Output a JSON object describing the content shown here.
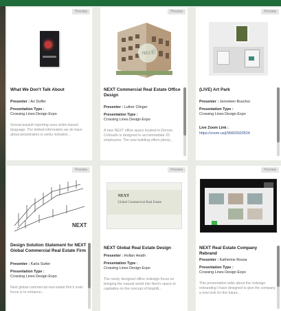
{
  "preview_label": "Preview",
  "cards": [
    {
      "title": "What We Don't Talk About",
      "presenter_label": "Presenter :",
      "presenter": "Ari Duffer",
      "type_label": "Presentation Type :",
      "type": "Crossing Lines Design Expo",
      "desc": "Sexual assault reporting uses victim-based language. The limited information we do have about perpetrators is rarely included...",
      "thumbnail_icon": "book-cover-image"
    },
    {
      "title": "NEXT Commercial Real Estate Office Design",
      "presenter_label": "Presenter :",
      "presenter": "Luther Clinger",
      "type_label": "Presentation Type :",
      "type": "Crossing Lines Design Expo",
      "desc": "A new NEXT office space located in Denver, Colorado is designed to accommodate 20 employees. The new building offers plenty...",
      "thumbnail_icon": "building-render-image"
    },
    {
      "title": "(LIVE) Art Park",
      "presenter_label": "Presenter :",
      "presenter": "Jenneken Buschur",
      "type_label": "Presentation Type :",
      "type": "Crossing Lines Design Expo",
      "extra_label": "Live Zoom Link :",
      "extra_value": "https://zoom.us/j/96820020524",
      "thumbnail_icon": "gallery-photo-image"
    },
    {
      "title": "Design Solution Statement for NEXT Global Commercial Real Estate Firm",
      "presenter_label": "Presenter :",
      "presenter": "Karla Sutter",
      "type_label": "Presentation Type :",
      "type": "Crossing Lines Design Expo",
      "desc": "Next global commercial real estate firm's main focus is to enhance...",
      "thumbnail_icon": "architecture-sketch-image"
    },
    {
      "title": "NEXT Global Real Estate Design",
      "presenter_label": "Presenter :",
      "presenter": "Hollan Heath",
      "type_label": "Presentation Type :",
      "type": "Crossing Lines Design Expo",
      "desc": "The newly designed office redesign focus on bringing the natural world into Next's space to capitalize on the concept of biophili...",
      "thumbnail_icon": "title-slide-image",
      "slide_title": "NEXT",
      "slide_subtitle": "Global Commercial Real Estate"
    },
    {
      "title": "NEXT Real Estate Company Rebrand",
      "presenter_label": "Presenter :",
      "presenter": "Katherine Rossa",
      "type_label": "Presentation Type :",
      "type": "Crossing Lines Design Expo",
      "desc": "This presentation talks about the redesign rebranding I have designed to give the company a new look for the future...",
      "thumbnail_icon": "video-call-image"
    }
  ]
}
